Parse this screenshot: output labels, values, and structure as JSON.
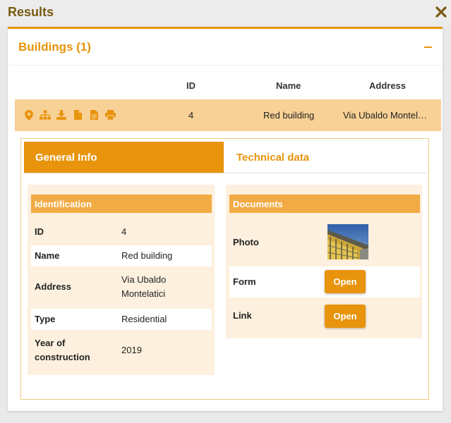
{
  "header": {
    "title": "Results"
  },
  "section": {
    "title": "Buildings (1)"
  },
  "table": {
    "columns": [
      "ID",
      "Name",
      "Address"
    ],
    "row": {
      "id": "4",
      "name": "Red building",
      "address": "Via Ubaldo Montel…"
    },
    "icons": [
      "location-pin-icon",
      "hierarchy-icon",
      "download-icon",
      "document-icon",
      "document-text-icon",
      "print-icon"
    ]
  },
  "tabs": [
    {
      "label": "General Info",
      "active": true
    },
    {
      "label": "Technical data",
      "active": false
    }
  ],
  "identification": {
    "title": "Identification",
    "fields": [
      {
        "key": "ID",
        "value": "4"
      },
      {
        "key": "Name",
        "value": "Red building"
      },
      {
        "key": "Address",
        "value_line1": "Via Ubaldo",
        "value_line2": "Montelatici"
      },
      {
        "key": "Type",
        "value": "Residential"
      },
      {
        "key_line1": "Year of",
        "key_line2": "construction",
        "value": "2019"
      }
    ]
  },
  "documents": {
    "title": "Documents",
    "photo_label": "Photo",
    "form_label": "Form",
    "form_button": "Open",
    "link_label": "Link",
    "link_button": "Open"
  },
  "colors": {
    "accent": "#e8940c",
    "row_highlight": "#f8d196",
    "card_bg": "#fdf0de",
    "card_head": "#f2ab44"
  }
}
